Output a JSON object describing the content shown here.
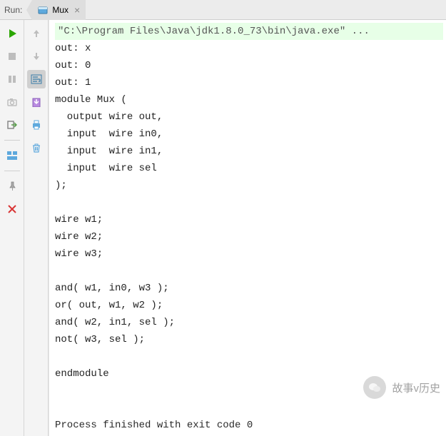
{
  "header": {
    "run_label": "Run:",
    "tab_title": "Mux",
    "tab_close_glyph": "×"
  },
  "console": {
    "command_line": "\"C:\\Program Files\\Java\\jdk1.8.0_73\\bin\\java.exe\" ...",
    "output_lines": [
      "out: x",
      "out: 0",
      "out: 1",
      "module Mux (",
      "  output wire out,",
      "  input  wire in0,",
      "  input  wire in1,",
      "  input  wire sel",
      ");",
      "",
      "wire w1;",
      "wire w2;",
      "wire w3;",
      "",
      "and( w1, in0, w3 );",
      "or( out, w1, w2 );",
      "and( w2, in1, sel );",
      "not( w3, sel );",
      "",
      "endmodule",
      "",
      ""
    ],
    "exit_line": "Process finished with exit code 0"
  },
  "icons": {
    "col1": [
      "run",
      "stop-square",
      "pause",
      "camera",
      "exit",
      "layout",
      "push-pin",
      "close-x"
    ],
    "col2": [
      "arrow-up",
      "arrow-down",
      "soft-wrap",
      "export",
      "print",
      "trash"
    ]
  },
  "watermark": {
    "text": "故事v历史",
    "logo_glyph": "◐"
  }
}
